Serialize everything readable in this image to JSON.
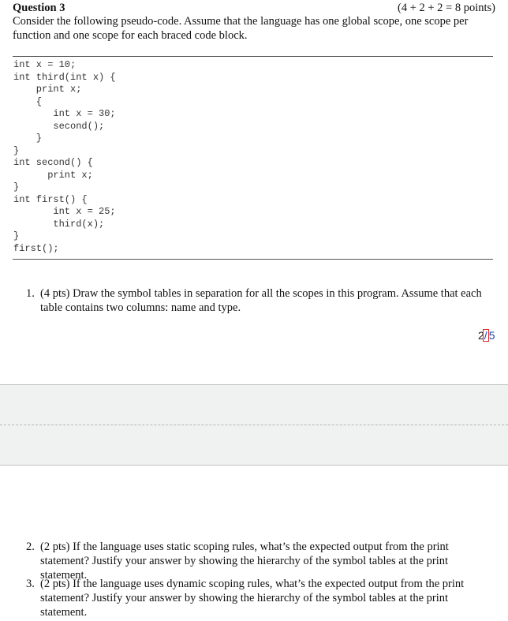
{
  "question": {
    "title": "Question 3",
    "points": "(4 + 2 + 2 = 8 points)",
    "intro": "Consider the following pseudo-code. Assume that the language has one global scope, one scope per function and one scope for each braced code block."
  },
  "code": {
    "lines": [
      "int x = 10;",
      "int third(int x) {",
      "    print x;",
      "    {",
      "       int x = 30;",
      "       second();",
      "    }",
      "}",
      "int second() {",
      "      print x;",
      "}",
      "int first() {",
      "       int x = 25;",
      "       third(x);",
      "}",
      "first();"
    ]
  },
  "items": [
    {
      "number": "1.",
      "text": "(4 pts) Draw the symbol tables in separation for all the scopes in this program. Assume that each table contains two columns: name and type."
    },
    {
      "number": "2.",
      "text": "(2 pts) If the language uses static scoping rules, what’s the expected output from the print statement? Justify your answer by showing the hierarchy of the symbol tables at the print statement."
    },
    {
      "number": "3.",
      "text": "(2 pts) If the language uses dynamic scoping rules, what’s the expected output from the print statement? Justify your answer by showing the hierarchy of the symbol tables at the print statement."
    }
  ],
  "page_indicator": {
    "current": "2",
    "separator": "/",
    "total": "5"
  },
  "colors": {
    "page_highlight_box": "#e02020",
    "gap_band": "#f0f1f1"
  }
}
